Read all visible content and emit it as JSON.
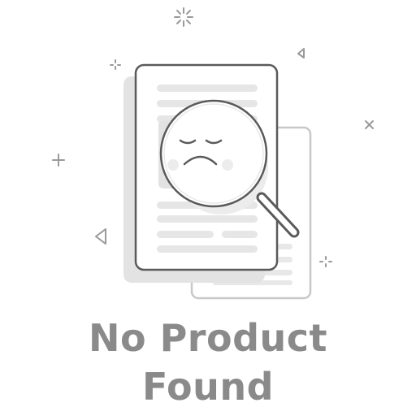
{
  "empty_state": {
    "title_line1": "No Product",
    "title_line2": "Found",
    "icon": "magnifier-sad-document-icon",
    "colors": {
      "stroke": "#5a5a5a",
      "line_fill": "#e6e6e6",
      "back_stroke": "#c8c8c8",
      "shadow": "#e3e3e3",
      "sparkle": "#9a9a9a",
      "text": "#8a8a8a"
    }
  }
}
